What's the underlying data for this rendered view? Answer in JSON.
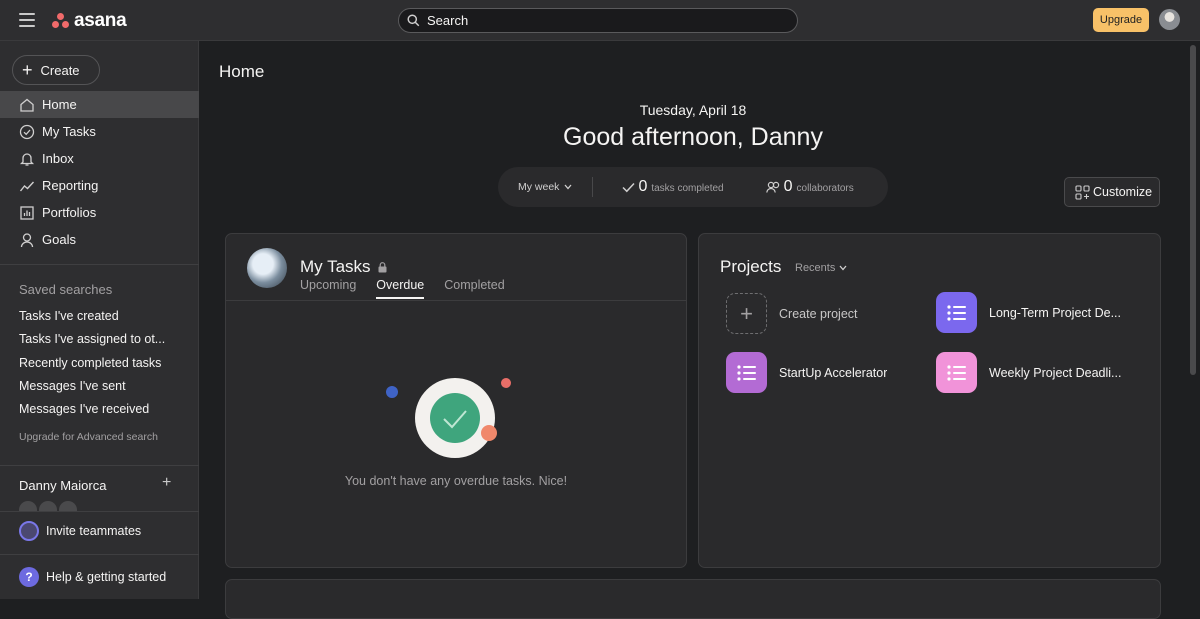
{
  "app": {
    "name": "asana"
  },
  "topbar": {
    "search_placeholder": "Search",
    "upgrade_label": "Upgrade"
  },
  "sidebar": {
    "create_label": "Create",
    "nav": [
      {
        "label": "Home",
        "icon": "home-icon"
      },
      {
        "label": "My Tasks",
        "icon": "check-circle-icon"
      },
      {
        "label": "Inbox",
        "icon": "bell-icon"
      },
      {
        "label": "Reporting",
        "icon": "trend-line-icon"
      },
      {
        "label": "Portfolios",
        "icon": "bar-chart-icon"
      },
      {
        "label": "Goals",
        "icon": "person-icon"
      }
    ],
    "saved_searches_title": "Saved searches",
    "saved_searches": [
      "Tasks I've created",
      "Tasks I've assigned to ot...",
      "Recently completed tasks",
      "Messages I've sent",
      "Messages I've received"
    ],
    "upgrade_link": "Upgrade for Advanced search",
    "team_name": "Danny Maiorca",
    "invite_label": "Invite teammates",
    "help_label": "Help & getting started"
  },
  "main": {
    "page_title": "Home",
    "date": "Tuesday, April 18",
    "greeting": "Good afternoon, Danny",
    "stats": {
      "period": "My week",
      "tasks_completed_value": "0",
      "tasks_completed_label": "tasks completed",
      "collaborators_value": "0",
      "collaborators_label": "collaborators"
    },
    "customize_label": "Customize",
    "my_tasks": {
      "title": "My Tasks",
      "tabs": [
        "Upcoming",
        "Overdue",
        "Completed"
      ],
      "active_tab": "Overdue",
      "empty_message": "You don't have any overdue tasks. Nice!"
    },
    "projects": {
      "title": "Projects",
      "filter": "Recents",
      "items": [
        {
          "label": "Create project",
          "color": ""
        },
        {
          "label": "Long-Term Project De...",
          "color": "#7b68ee"
        },
        {
          "label": "StartUp Accelerator",
          "color": "#b36bd4"
        },
        {
          "label": "Weekly Project Deadli...",
          "color": "#f193d9"
        }
      ]
    }
  },
  "colors": {
    "accent_upgrade": "#f8c168",
    "brand_logo": "#f06a6a"
  }
}
